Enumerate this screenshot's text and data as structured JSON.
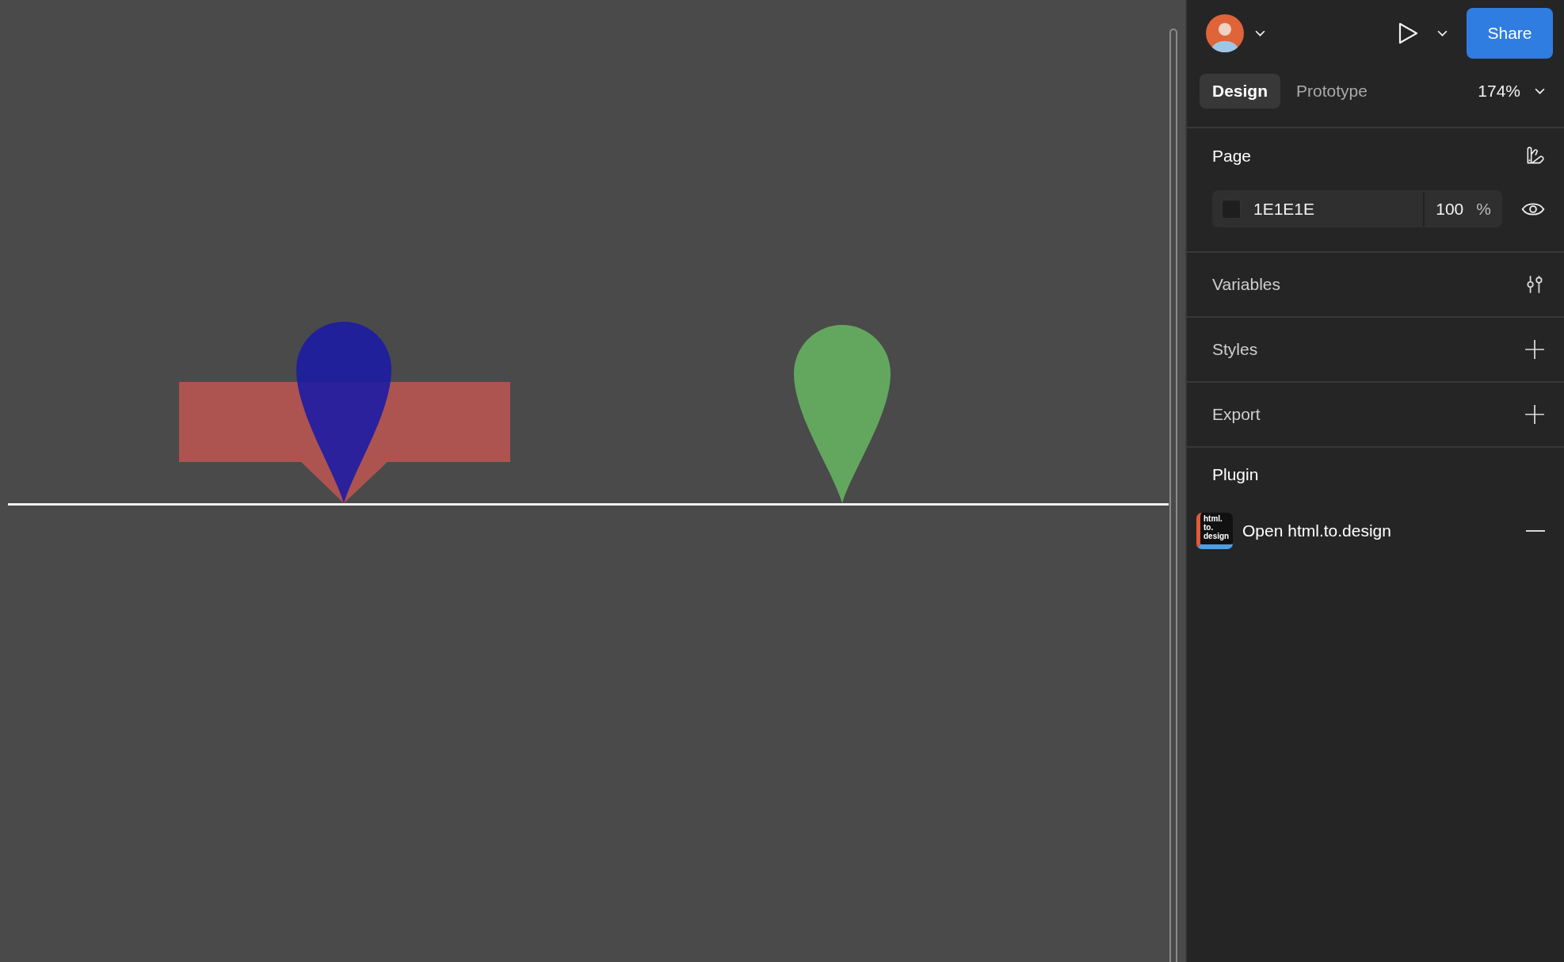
{
  "header": {
    "share_button": "Share"
  },
  "tabs": [
    {
      "label": "Design",
      "selected": true
    },
    {
      "label": "Prototype",
      "selected": false
    }
  ],
  "zoom": "174%",
  "page": {
    "title": "Page",
    "fill": {
      "hex": "1E1E1E",
      "opacity": "100",
      "unit": "%",
      "visible": true
    }
  },
  "sections": [
    {
      "title": "Variables",
      "kind": "settings"
    },
    {
      "title": "Styles",
      "kind": "add"
    },
    {
      "title": "Export",
      "kind": "add"
    }
  ],
  "plugin": {
    "title": "Plugin",
    "items": [
      {
        "label": "Open html.to.design",
        "icon_text": [
          "html.",
          "to.",
          "design"
        ]
      }
    ]
  }
}
